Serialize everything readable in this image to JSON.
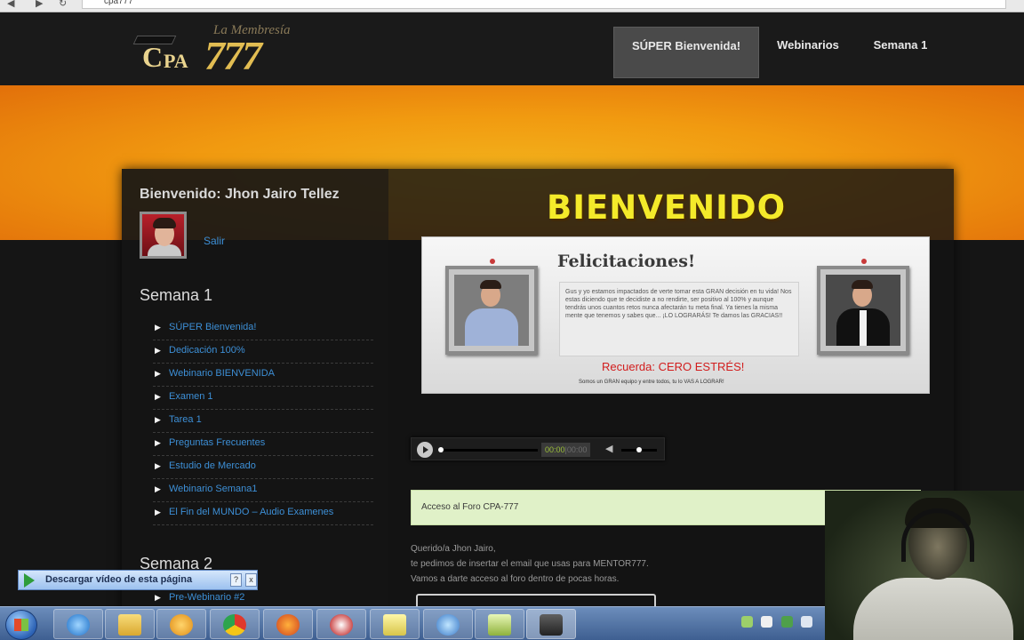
{
  "browser": {
    "url_fragment": "cpa777"
  },
  "header": {
    "logo": {
      "tagline": "La Membresía",
      "brand_c": "C",
      "brand_pa": "PA",
      "brand_777": "777"
    },
    "nav": [
      {
        "label": "SÚPER Bienvenida!",
        "active": true
      },
      {
        "label": "Webinarios",
        "active": false
      },
      {
        "label": "Semana 1",
        "active": false
      }
    ]
  },
  "sidebar": {
    "welcome": "Bienvenido: Jhon Jairo Tellez",
    "logout": "Salir",
    "week1": {
      "title": "Semana 1",
      "items": [
        "SÚPER Bienvenida!",
        "Dedicación 100%",
        "Webinario BIENVENIDA",
        "Examen 1",
        "Tarea 1",
        "Preguntas Frecuentes",
        "Estudio de Mercado",
        "Webinario Semana1",
        "El Fin del MUNDO – Audio Examenes"
      ]
    },
    "week2": {
      "title": "Semana 2",
      "items": [
        "Pre-Webinario #2"
      ]
    }
  },
  "main": {
    "heading": "BIENVENIDO",
    "card": {
      "title": "Felicitaciones!",
      "body": "Gus y yo estamos impactados de verte tomar esta GRAN decisión en tu vida! Nos estas diciendo que te decidiste a no rendirte, ser positivo al 100% y aunque tendrás unos cuantos retos nunca afectarán tu meta final. Ya tienes la misma mente que tenemos y sabes que... ¡LO LOGRARÁS! Te damos las GRACIAS!!",
      "recuerda": "Recuerda: CERO ESTRÉS!",
      "footer": "Somos un GRAN equipo y entre todos, tu lo VAS A LOGRAR!"
    },
    "audio": {
      "current_time": "00:00",
      "duration": "00:00",
      "progress": 0,
      "volume": 0.5
    },
    "forum": {
      "label": "Acceso al Foro CPA-777",
      "lines": [
        "Querido/a Jhon Jairo,",
        "te pedimos de insertar el email que usas para MENTOR777.",
        "Vamos a darte acceso al foro dentro de pocas horas."
      ]
    }
  },
  "download_bar": {
    "label": "Descargar vídeo de esta página",
    "help": "?",
    "close": "x"
  },
  "taskbar": {
    "buttons": [
      "internet-explorer",
      "file-explorer",
      "media-player",
      "chrome",
      "firefox",
      "messenger",
      "sticky-notes",
      "network",
      "sticky-notes-2",
      "camera-recorder"
    ]
  },
  "colors": {
    "accent_orange": "#f19a10",
    "heading_yellow": "#f4ea2a",
    "link_blue": "#3d8fd6",
    "recuerda_red": "#d21d1d"
  }
}
